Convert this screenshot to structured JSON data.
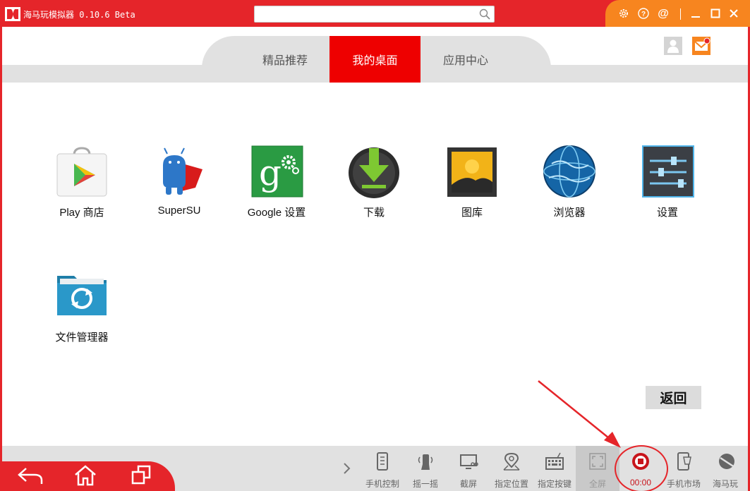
{
  "window": {
    "title": "海马玩模拟器 0.10.6 Beta",
    "search_placeholder": ""
  },
  "titlebar_icons": [
    "gear-icon",
    "help-icon",
    "at-icon",
    "minimize-icon",
    "maximize-icon",
    "close-icon"
  ],
  "tabs": [
    {
      "label": "精品推荐",
      "active": false
    },
    {
      "label": "我的桌面",
      "active": true
    },
    {
      "label": "应用中心",
      "active": false
    }
  ],
  "apps": [
    {
      "label": "Play 商店",
      "icon": "play-store-icon"
    },
    {
      "label": "SuperSU",
      "icon": "supersu-icon"
    },
    {
      "label": "Google 设置",
      "icon": "google-settings-icon"
    },
    {
      "label": "下载",
      "icon": "download-icon"
    },
    {
      "label": "图库",
      "icon": "gallery-icon"
    },
    {
      "label": "浏览器",
      "icon": "browser-icon"
    },
    {
      "label": "设置",
      "icon": "settings-icon"
    },
    {
      "label": "文件管理器",
      "icon": "file-manager-icon"
    }
  ],
  "back_button": "返回",
  "toolbar": {
    "items": [
      {
        "label": "手机控制",
        "icon": "phone-control-icon"
      },
      {
        "label": "摇一摇",
        "icon": "shake-icon"
      },
      {
        "label": "截屏",
        "icon": "screenshot-icon"
      },
      {
        "label": "指定位置",
        "icon": "location-icon"
      },
      {
        "label": "指定按键",
        "icon": "keymap-icon"
      },
      {
        "label": "全屏",
        "icon": "fullscreen-icon"
      },
      {
        "label": "00:00",
        "icon": "record-stop-icon"
      },
      {
        "label": "手机市场",
        "icon": "phone-market-icon"
      },
      {
        "label": "海马玩",
        "icon": "haimawan-icon"
      }
    ]
  },
  "colors": {
    "brand_red": "#e5252a",
    "active_tab": "#ee0000",
    "orange": "#f7851f",
    "bar_grey": "#e1e1e1",
    "record_red": "#c8141b"
  }
}
